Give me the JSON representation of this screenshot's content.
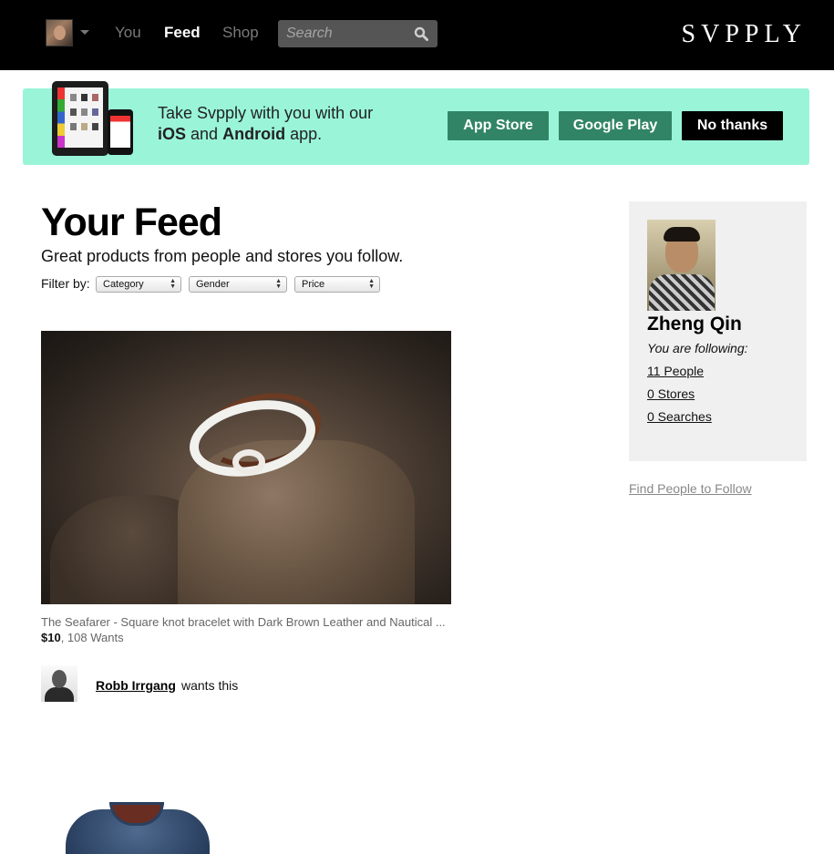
{
  "nav": {
    "you": "You",
    "feed": "Feed",
    "shop": "Shop",
    "search_placeholder": "Search",
    "logo": "SVPPLY"
  },
  "banner": {
    "text_line1": "Take Svpply with you with our",
    "ios": "iOS",
    "and": "and",
    "android": "Android",
    "app": "app.",
    "app_store": "App Store",
    "google_play": "Google Play",
    "no_thanks": "No thanks",
    "colors": {
      "background": "#9af5d8",
      "store_buttons": "#318566"
    }
  },
  "feed": {
    "title": "Your Feed",
    "subtitle": "Great products from people and stores you follow.",
    "filter_label": "Filter by:",
    "filters": {
      "category": "Category",
      "gender": "Gender",
      "price": "Price"
    }
  },
  "product": {
    "title": "The Seafarer - Square knot bracelet with Dark Brown Leather and Nautical ...",
    "price": "$10",
    "wants": ", 108 Wants",
    "wanter_name": "Robb Irrgang",
    "wanter_action": "wants this"
  },
  "sidebar": {
    "name": "Zheng Qin",
    "following_label": "You are following:",
    "people": "11 People",
    "stores": "0 Stores",
    "searches": "0 Searches",
    "find_people": "Find People to Follow"
  }
}
